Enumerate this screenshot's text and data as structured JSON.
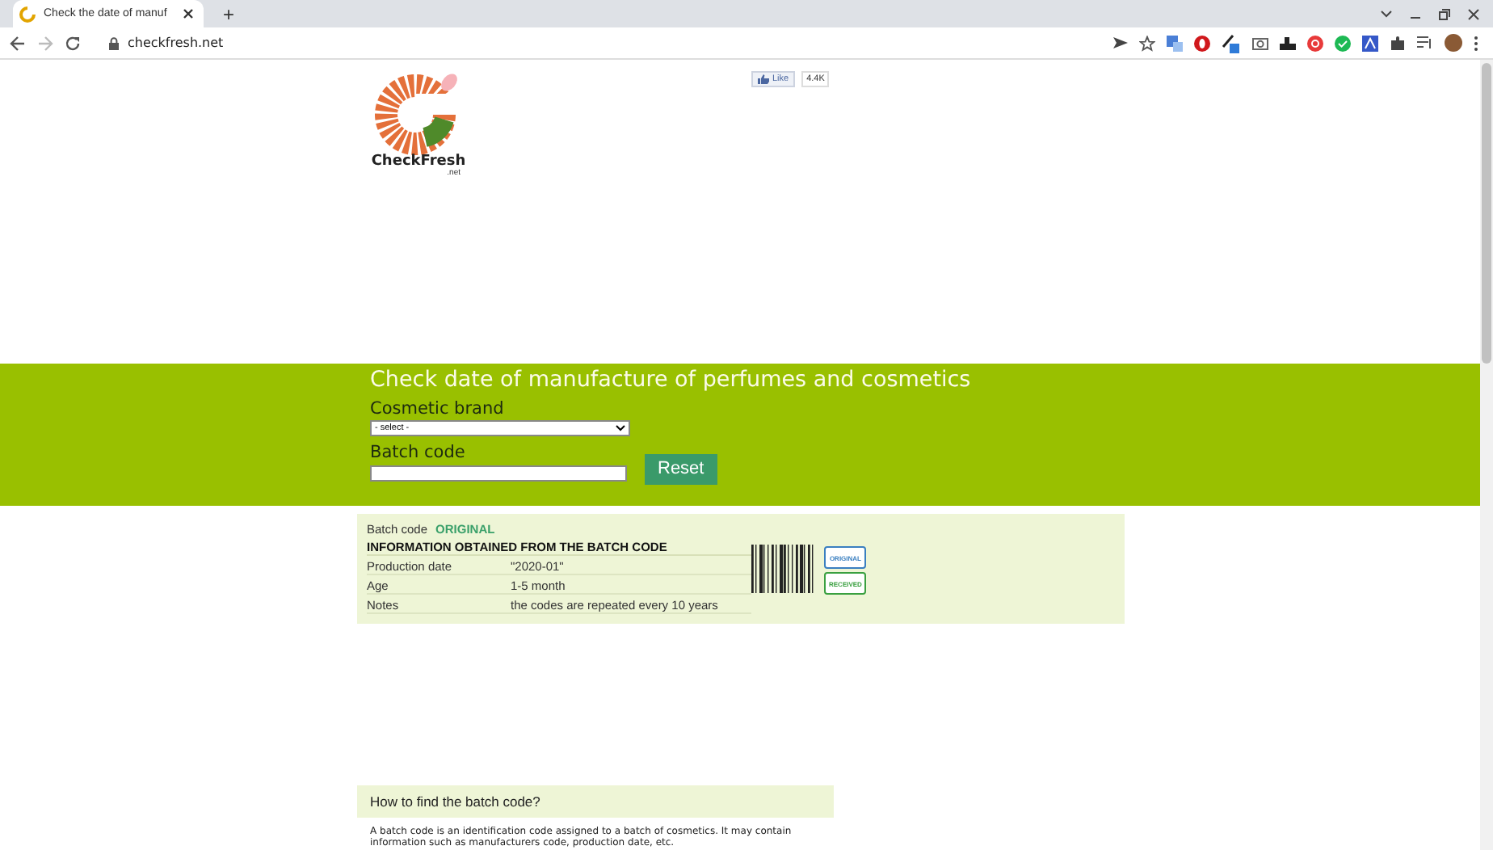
{
  "browser": {
    "tab_title": "Check the date of manuf",
    "new_tab": "+",
    "url": "checkfresh.net"
  },
  "header": {
    "logo_text": "CheckFresh",
    "logo_suffix": ".net",
    "like_label": "Like",
    "like_count": "4.4K"
  },
  "form": {
    "title": "Check date of manufacture of perfumes and cosmetics",
    "brand_label": "Cosmetic brand",
    "brand_value": "- select -",
    "batch_label": "Batch code",
    "reset": "Reset"
  },
  "result": {
    "label": "Batch code",
    "status": "ORIGINAL",
    "heading": "INFORMATION OBTAINED FROM THE BATCH CODE",
    "rows": [
      {
        "name": "Production date",
        "value": "\"2020-01\""
      },
      {
        "name": "Age",
        "value": "1-5 month"
      },
      {
        "name": "Notes",
        "value": "the codes are repeated every 10 years"
      }
    ],
    "stamps": [
      "ORIGINAL",
      "RECEIVED"
    ]
  },
  "faq": {
    "title": "How to find the batch code?",
    "text": "A batch code is an identification code assigned to a batch of cosmetics. It may contain information such as manufacturers code, production date, etc."
  }
}
